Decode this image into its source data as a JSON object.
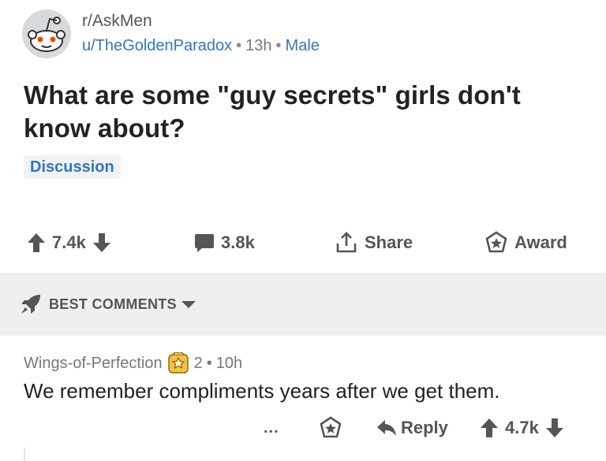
{
  "post": {
    "subreddit": "r/AskMen",
    "author": "u/TheGoldenParadox",
    "age": "13h",
    "user_flair": "Male",
    "separator": "•",
    "title": "What are some \"guy secrets\" girls don't know about?",
    "post_flair": "Discussion"
  },
  "actions": {
    "upvotes": "7.4k",
    "comments": "3.8k",
    "share_label": "Share",
    "award_label": "Award"
  },
  "sort": {
    "label": "BEST COMMENTS"
  },
  "comment": {
    "author": "Wings-of-Perfection",
    "badge_count": "2",
    "age": "10h",
    "separator": "•",
    "body": "We remember compliments years after we get them.",
    "more_label": "...",
    "reply_label": "Reply",
    "score": "4.7k"
  },
  "colors": {
    "link_blue": "#3276c5",
    "icon_gray": "#555555",
    "sort_bar_bg": "#edeff1",
    "flair_bg": "#f0f2f4",
    "badge_gold": "#f5c242"
  },
  "icons": {
    "avatar": "snoo-avatar-icon",
    "upvote": "arrow-up-icon",
    "downvote": "arrow-down-icon",
    "comment": "comment-bubble-icon",
    "share": "share-icon",
    "award": "award-star-icon",
    "sort": "rocket-icon",
    "dropdown": "caret-down-icon",
    "badge": "award-badge-icon",
    "more": "more-dots-icon"
  }
}
